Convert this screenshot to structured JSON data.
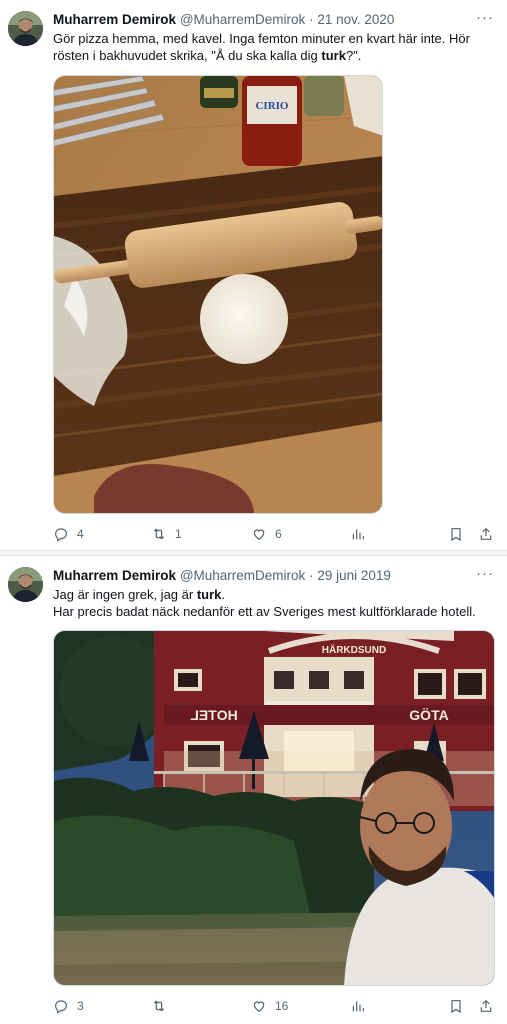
{
  "tweets": [
    {
      "author_name": "Muharrem Demirok",
      "author_handle": "@MuharremDemirok",
      "separator": "·",
      "date": "21 nov. 2020",
      "text_line1": "Gör pizza hemma, med kavel. Inga femton minuter en kvart här inte.  Hör",
      "text_line2_prefix": "rösten i bakhuvudet skrika, \"Å du ska kalla dig ",
      "text_line2_bold": "turk",
      "text_line2_suffix": "?\".",
      "more_label": "···",
      "replies": "4",
      "retweets": "1",
      "likes": "6",
      "bottle_label": "CIRIO"
    },
    {
      "author_name": "Muharrem Demirok",
      "author_handle": "@MuharremDemirok",
      "separator": "·",
      "date": "29 juni 2019",
      "text_line1_prefix": "Jag är ingen grek, jag är ",
      "text_line1_bold": "turk",
      "text_line1_suffix": ".",
      "text_line2": "Har precis badat näck nedanför ett av Sveriges mest kultförklarade hotell.",
      "more_label": "···",
      "replies": "3",
      "retweets": "",
      "likes": "16",
      "sign_left": "HOTEL",
      "sign_right": "GÖTA",
      "sign_arch": "HÄRKDSUND"
    }
  ],
  "icons": {
    "reply": "reply-icon",
    "retweet": "retweet-icon",
    "like": "heart-icon",
    "views": "analytics-icon",
    "bookmark": "bookmark-icon",
    "share": "share-icon",
    "more": "more-icon"
  }
}
